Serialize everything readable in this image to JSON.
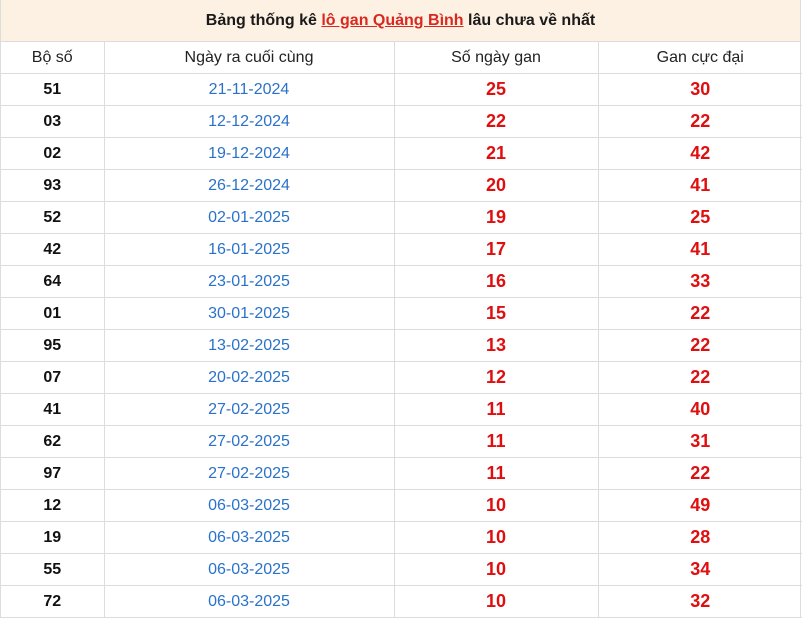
{
  "title": {
    "prefix": "Bảng thống kê ",
    "link": "lô gan Quảng Bình",
    "suffix": " lâu chưa về nhất"
  },
  "columns": [
    "Bộ số",
    "Ngày ra cuối cùng",
    "Số ngày gan",
    "Gan cực đại"
  ],
  "rows": [
    {
      "bo_so": "51",
      "ngay": "21-11-2024",
      "so_ngay": "25",
      "gan_max": "30"
    },
    {
      "bo_so": "03",
      "ngay": "12-12-2024",
      "so_ngay": "22",
      "gan_max": "22"
    },
    {
      "bo_so": "02",
      "ngay": "19-12-2024",
      "so_ngay": "21",
      "gan_max": "42"
    },
    {
      "bo_so": "93",
      "ngay": "26-12-2024",
      "so_ngay": "20",
      "gan_max": "41"
    },
    {
      "bo_so": "52",
      "ngay": "02-01-2025",
      "so_ngay": "19",
      "gan_max": "25"
    },
    {
      "bo_so": "42",
      "ngay": "16-01-2025",
      "so_ngay": "17",
      "gan_max": "41"
    },
    {
      "bo_so": "64",
      "ngay": "23-01-2025",
      "so_ngay": "16",
      "gan_max": "33"
    },
    {
      "bo_so": "01",
      "ngay": "30-01-2025",
      "so_ngay": "15",
      "gan_max": "22"
    },
    {
      "bo_so": "95",
      "ngay": "13-02-2025",
      "so_ngay": "13",
      "gan_max": "22"
    },
    {
      "bo_so": "07",
      "ngay": "20-02-2025",
      "so_ngay": "12",
      "gan_max": "22"
    },
    {
      "bo_so": "41",
      "ngay": "27-02-2025",
      "so_ngay": "11",
      "gan_max": "40"
    },
    {
      "bo_so": "62",
      "ngay": "27-02-2025",
      "so_ngay": "11",
      "gan_max": "31"
    },
    {
      "bo_so": "97",
      "ngay": "27-02-2025",
      "so_ngay": "11",
      "gan_max": "22"
    },
    {
      "bo_so": "12",
      "ngay": "06-03-2025",
      "so_ngay": "10",
      "gan_max": "49"
    },
    {
      "bo_so": "19",
      "ngay": "06-03-2025",
      "so_ngay": "10",
      "gan_max": "28"
    },
    {
      "bo_so": "55",
      "ngay": "06-03-2025",
      "so_ngay": "10",
      "gan_max": "34"
    },
    {
      "bo_so": "72",
      "ngay": "06-03-2025",
      "so_ngay": "10",
      "gan_max": "32"
    }
  ],
  "colors": {
    "date": "#2a72c9",
    "highlight": "#e00f0f",
    "title_bg": "#fdf1e4"
  }
}
